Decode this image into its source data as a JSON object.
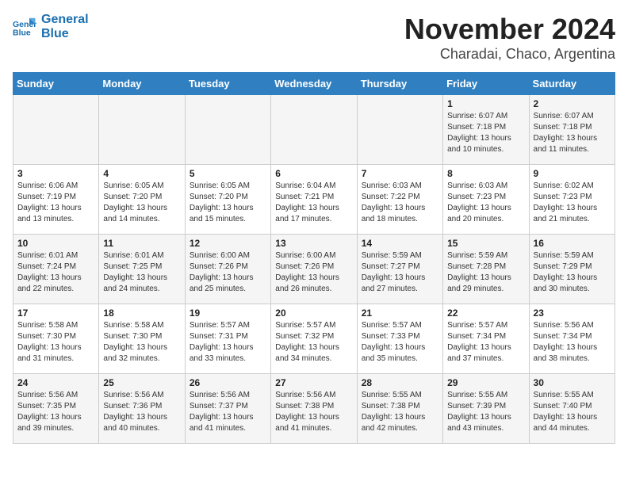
{
  "logo": {
    "line1": "General",
    "line2": "Blue"
  },
  "title": "November 2024",
  "location": "Charadai, Chaco, Argentina",
  "weekdays": [
    "Sunday",
    "Monday",
    "Tuesday",
    "Wednesday",
    "Thursday",
    "Friday",
    "Saturday"
  ],
  "weeks": [
    [
      {
        "day": "",
        "info": ""
      },
      {
        "day": "",
        "info": ""
      },
      {
        "day": "",
        "info": ""
      },
      {
        "day": "",
        "info": ""
      },
      {
        "day": "",
        "info": ""
      },
      {
        "day": "1",
        "info": "Sunrise: 6:07 AM\nSunset: 7:18 PM\nDaylight: 13 hours\nand 10 minutes."
      },
      {
        "day": "2",
        "info": "Sunrise: 6:07 AM\nSunset: 7:18 PM\nDaylight: 13 hours\nand 11 minutes."
      }
    ],
    [
      {
        "day": "3",
        "info": "Sunrise: 6:06 AM\nSunset: 7:19 PM\nDaylight: 13 hours\nand 13 minutes."
      },
      {
        "day": "4",
        "info": "Sunrise: 6:05 AM\nSunset: 7:20 PM\nDaylight: 13 hours\nand 14 minutes."
      },
      {
        "day": "5",
        "info": "Sunrise: 6:05 AM\nSunset: 7:20 PM\nDaylight: 13 hours\nand 15 minutes."
      },
      {
        "day": "6",
        "info": "Sunrise: 6:04 AM\nSunset: 7:21 PM\nDaylight: 13 hours\nand 17 minutes."
      },
      {
        "day": "7",
        "info": "Sunrise: 6:03 AM\nSunset: 7:22 PM\nDaylight: 13 hours\nand 18 minutes."
      },
      {
        "day": "8",
        "info": "Sunrise: 6:03 AM\nSunset: 7:23 PM\nDaylight: 13 hours\nand 20 minutes."
      },
      {
        "day": "9",
        "info": "Sunrise: 6:02 AM\nSunset: 7:23 PM\nDaylight: 13 hours\nand 21 minutes."
      }
    ],
    [
      {
        "day": "10",
        "info": "Sunrise: 6:01 AM\nSunset: 7:24 PM\nDaylight: 13 hours\nand 22 minutes."
      },
      {
        "day": "11",
        "info": "Sunrise: 6:01 AM\nSunset: 7:25 PM\nDaylight: 13 hours\nand 24 minutes."
      },
      {
        "day": "12",
        "info": "Sunrise: 6:00 AM\nSunset: 7:26 PM\nDaylight: 13 hours\nand 25 minutes."
      },
      {
        "day": "13",
        "info": "Sunrise: 6:00 AM\nSunset: 7:26 PM\nDaylight: 13 hours\nand 26 minutes."
      },
      {
        "day": "14",
        "info": "Sunrise: 5:59 AM\nSunset: 7:27 PM\nDaylight: 13 hours\nand 27 minutes."
      },
      {
        "day": "15",
        "info": "Sunrise: 5:59 AM\nSunset: 7:28 PM\nDaylight: 13 hours\nand 29 minutes."
      },
      {
        "day": "16",
        "info": "Sunrise: 5:59 AM\nSunset: 7:29 PM\nDaylight: 13 hours\nand 30 minutes."
      }
    ],
    [
      {
        "day": "17",
        "info": "Sunrise: 5:58 AM\nSunset: 7:30 PM\nDaylight: 13 hours\nand 31 minutes."
      },
      {
        "day": "18",
        "info": "Sunrise: 5:58 AM\nSunset: 7:30 PM\nDaylight: 13 hours\nand 32 minutes."
      },
      {
        "day": "19",
        "info": "Sunrise: 5:57 AM\nSunset: 7:31 PM\nDaylight: 13 hours\nand 33 minutes."
      },
      {
        "day": "20",
        "info": "Sunrise: 5:57 AM\nSunset: 7:32 PM\nDaylight: 13 hours\nand 34 minutes."
      },
      {
        "day": "21",
        "info": "Sunrise: 5:57 AM\nSunset: 7:33 PM\nDaylight: 13 hours\nand 35 minutes."
      },
      {
        "day": "22",
        "info": "Sunrise: 5:57 AM\nSunset: 7:34 PM\nDaylight: 13 hours\nand 37 minutes."
      },
      {
        "day": "23",
        "info": "Sunrise: 5:56 AM\nSunset: 7:34 PM\nDaylight: 13 hours\nand 38 minutes."
      }
    ],
    [
      {
        "day": "24",
        "info": "Sunrise: 5:56 AM\nSunset: 7:35 PM\nDaylight: 13 hours\nand 39 minutes."
      },
      {
        "day": "25",
        "info": "Sunrise: 5:56 AM\nSunset: 7:36 PM\nDaylight: 13 hours\nand 40 minutes."
      },
      {
        "day": "26",
        "info": "Sunrise: 5:56 AM\nSunset: 7:37 PM\nDaylight: 13 hours\nand 41 minutes."
      },
      {
        "day": "27",
        "info": "Sunrise: 5:56 AM\nSunset: 7:38 PM\nDaylight: 13 hours\nand 41 minutes."
      },
      {
        "day": "28",
        "info": "Sunrise: 5:55 AM\nSunset: 7:38 PM\nDaylight: 13 hours\nand 42 minutes."
      },
      {
        "day": "29",
        "info": "Sunrise: 5:55 AM\nSunset: 7:39 PM\nDaylight: 13 hours\nand 43 minutes."
      },
      {
        "day": "30",
        "info": "Sunrise: 5:55 AM\nSunset: 7:40 PM\nDaylight: 13 hours\nand 44 minutes."
      }
    ]
  ]
}
